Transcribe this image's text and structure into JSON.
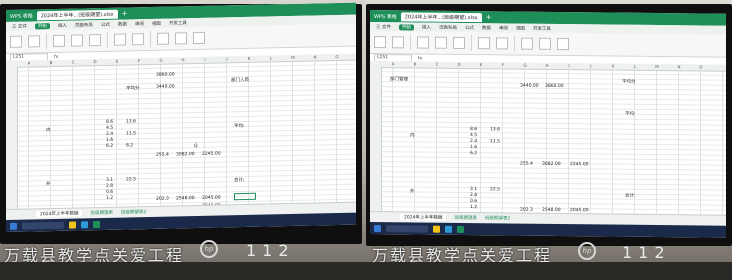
{
  "photos": [
    {
      "app_badge": "WPS 表格",
      "tab_title": "2024年上半年...(班级期望).xlsx",
      "menu": [
        "三 文件",
        "开始",
        "插入",
        "页面布局",
        "公式",
        "数据",
        "审阅",
        "视图",
        "开发工具",
        "会员专享",
        "效率"
      ],
      "menu_active": "开始",
      "name_box": "L251",
      "fx": "fx",
      "columns": [
        "A",
        "B",
        "C",
        "D",
        "E",
        "F",
        "G",
        "H",
        "I",
        "J",
        "K",
        "L",
        "M",
        "N",
        "O"
      ],
      "cells": [
        "平均分",
        "3440.00",
        "部门人员",
        "3860.00",
        "内",
        "平均:",
        "8.6",
        "4.5",
        "2.4",
        "13.6",
        "1.6",
        "6.2",
        "11.5",
        "8.2",
        "255.4",
        "3082.00",
        "2245.00",
        "Q",
        "外",
        "3.1",
        "2.8",
        "0.6",
        "1.2",
        "22.5",
        "202.3",
        "2548.00",
        "2045.00",
        "合计:",
        "3045.00"
      ],
      "sheet_tabs": [
        "2024年上半年数据",
        "班级期望表",
        "班级期望表2"
      ],
      "brand_text": "万载县教学点关爱工程",
      "room_number": "112",
      "logo": "hp"
    },
    {
      "app_badge": "WPS 表格",
      "tab_title": "2024年上半年...(班级期望).xlsx",
      "menu": [
        "三 文件",
        "开始",
        "插入",
        "页面布局",
        "公式",
        "数据",
        "审阅",
        "视图",
        "开发工具",
        "会员专享",
        "效率"
      ],
      "menu_active": "开始",
      "name_box": "L251",
      "fx": "fx",
      "columns": [
        "A",
        "B",
        "C",
        "D",
        "E",
        "F",
        "G",
        "H",
        "I",
        "J",
        "K",
        "L",
        "M",
        "N",
        "O"
      ],
      "cells": [
        "部门管理",
        "平均分",
        "3440.00",
        "3860.00",
        "内",
        "平均:",
        "8.6",
        "4.5",
        "2.4",
        "13.6",
        "1.6",
        "6.2",
        "11.5",
        "255.4",
        "3082.00",
        "2245.00",
        "外",
        "3.1",
        "2.8",
        "0.6",
        "1.2",
        "22.5",
        "202.3",
        "2548.00",
        "2045.00",
        "合计:"
      ],
      "sheet_tabs": [
        "2024年上半年数据",
        "班级期望表",
        "班级期望表2"
      ],
      "brand_text": "万载县教学点关爱工程",
      "room_number": "112",
      "logo": "hp"
    }
  ]
}
